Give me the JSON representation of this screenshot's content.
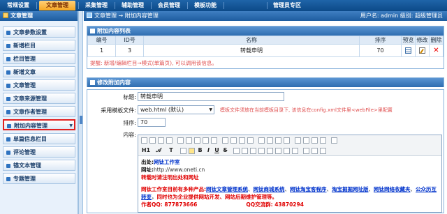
{
  "topnav": {
    "tabs": [
      "常规设置",
      "文章管理",
      "采集管理",
      "辅助管理",
      "会员管理",
      "模板功能",
      "",
      "管理员专区"
    ],
    "active_index": 1
  },
  "sidebar": {
    "title": "文章管理",
    "items": [
      "文章参数设置",
      "新增栏目",
      "栏目管理",
      "新增文章",
      "文章管理",
      "文章来源管理",
      "文章作者管理",
      "附加内容管理",
      "单篇信息栏目",
      "评论管理",
      "锚文本管理",
      "专题管理"
    ],
    "selected_index": 7
  },
  "header": {
    "breadcrumb": "文章管理 → 附加内容管理",
    "user": "用户名: admin   级别: 超级管理员"
  },
  "list_panel": {
    "title": "附加内容列表",
    "columns": [
      "编号",
      "ID号",
      "名称",
      "排序",
      "预览",
      "修改",
      "删除"
    ],
    "rows": [
      {
        "no": "1",
        "id": "3",
        "name": "转载申明",
        "order": "70"
      }
    ],
    "tip": "提醒: 新增/编辑栏目→模式(单篇页), 可以调用该信息。"
  },
  "edit_panel": {
    "title": "修改附加内容",
    "title_label": "标题:",
    "title_value": "转载申明",
    "template_label": "采用模板文件:",
    "template_value": "web.html (默认)",
    "template_hint": "模板文件须放在当前模板目录下, 该信息在config.xml文件里<webFile>里配置",
    "order_label": "排序:",
    "order_value": "70",
    "content_label": "内容:"
  },
  "editor": {
    "line1_label": "出处:",
    "line1_value": "网钛工作室",
    "line2_label": "网址:",
    "line2_value": "http://www.oneti.cn",
    "line3": "转载时请注明出处和网址",
    "para_prefix": "网钛工作室目前有多种产品:",
    "products": [
      "网钛文章管理系统",
      "网钛商城系统",
      "网钛淘宝客程序",
      "淘宝掘掘网址版",
      "网钛网络收藏夹",
      "公众历互转变"
    ],
    "para_suffix": "同时也为企业提供网站开发、网站后期维护管理等。",
    "qq_author": "作者QQ: 877873666",
    "qq_group": "QQ交流群: 43870294"
  }
}
